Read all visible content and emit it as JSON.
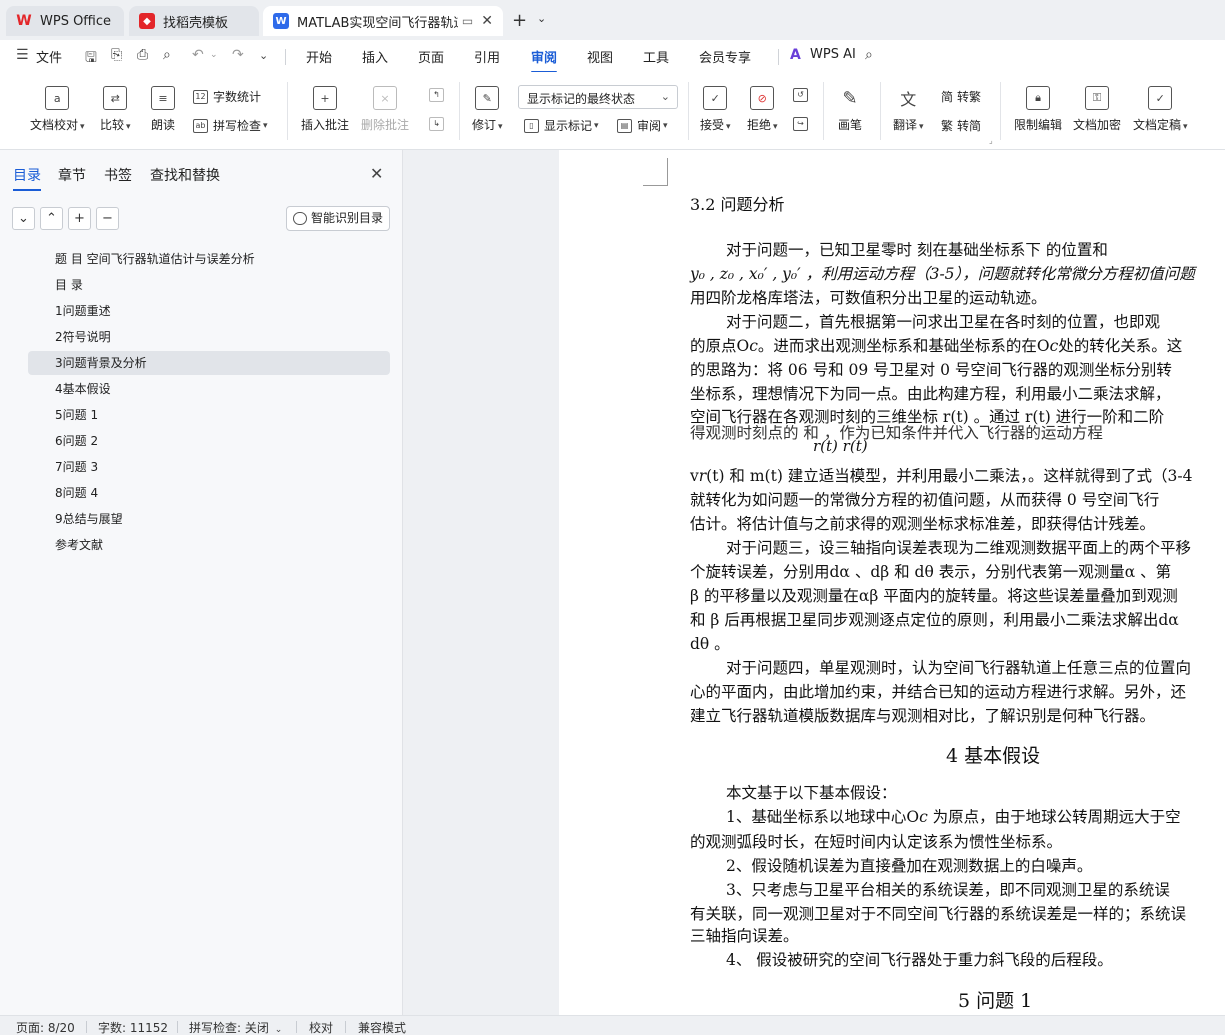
{
  "tabs": [
    {
      "label": "WPS Office",
      "icon": "wps-logo-icon"
    },
    {
      "label": "找稻壳模板",
      "icon": "docer-icon"
    },
    {
      "label": "MATLAB实现空间飞行器轨道估计",
      "icon": "writer-doc-icon",
      "active": true
    }
  ],
  "menu": {
    "file": "文件",
    "tabs": [
      "开始",
      "插入",
      "页面",
      "引用",
      "审阅",
      "视图",
      "工具",
      "会员专享"
    ],
    "active_tab": "审阅",
    "ai": "WPS AI"
  },
  "ribbon": {
    "doc_proof": "文档校对",
    "compare": "比较",
    "read_aloud": "朗读",
    "word_count": "字数统计",
    "spell_check": "拼写检查",
    "insert_comment": "插入批注",
    "delete_comment": "删除批注",
    "revise": "修订",
    "markup_mode": "显示标记的最终状态",
    "show_markup": "显示标记",
    "review_pane": "审阅",
    "accept": "接受",
    "reject": "拒绝",
    "pen": "画笔",
    "translate": "翻译",
    "to_traditional": "转繁",
    "to_simplified": "转简",
    "restrict_edit": "限制编辑",
    "encrypt": "文档加密",
    "finalize": "文档定稿"
  },
  "sidebar": {
    "tabs": [
      "目录",
      "章节",
      "书签",
      "查找和替换"
    ],
    "active_tab": "目录",
    "smart_toc": "智能识别目录",
    "toc": [
      "题 目 空间飞行器轨道估计与误差分析",
      "目 录",
      "1问题重述",
      "2符号说明",
      "3问题背景及分析",
      "4基本假设",
      "5问题 1",
      "6问题 2",
      "7问题 3",
      "8问题 4",
      "9总结与展望",
      "参考文献"
    ],
    "selected_index": 4
  },
  "document": {
    "section_title": "3.2  问题分析",
    "lines": [
      "对于问题一，已知卫星零时  刻在基础坐标系下  的位置和",
      "y₀ , z₀ , x₀′ , y₀′ ，利用运动方程（3-5），问题就转化常微分方程初值问题",
      "用四阶龙格库塔法，可数值积分出卫星的运动轨迹。",
      "对于问题二，首先根据第一问求出卫星在各时刻的位置，也即观",
      "的原点O𝑐。进而求出观测坐标系和基础坐标系的在O𝑐处的转化关系。这",
      "的思路为：将  06 号和  09 号卫星对  0 号空间飞行器的观测坐标分别转",
      "坐标系，理想情况下为同一点。由此构建方程，利用最小二乘法求解，",
      "空间飞行器在各观测时刻的三维坐标  r(t) 。通过 r(t) 进行一阶和二阶",
      "得观测时刻点的      和      ，作为已知条件并代入飞行器的运动方程",
      "v𝑟(t) 和 m(t) 建立适当模型，并利用最小二乘法，。这样就得到了式（3-4",
      "就转化为如问题一的常微分方程的初值问题，从而获得  0 号空间飞行",
      "估计。将估计值与之前求得的观测坐标求标准差，即获得估计残差。",
      "对于问题三，设三轴指向误差表现为二维观测数据平面上的两个平移",
      "个旋转误差，分别用dα 、dβ 和 dθ 表示，分别代表第一观测量α 、第",
      "β 的平移量以及观测量在αβ 平面内的旋转量。将这些误差量叠加到观测",
      "和 β 后再根据卫星同步观测逐点定位的原则，利用最小二乘法求解出dα",
      "dθ 。",
      "对于问题四，单星观测时，认为空间飞行器轨道上任意三点的位置向",
      "心的平面内，由此增加约束，并结合已知的运动方程进行求解。另外，还",
      "建立飞行器轨道模版数据库与观测相对比，了解识别是何种飞行器。"
    ],
    "formula_fragment": "r(t)    r(t)",
    "heading_4": "4 基本假设",
    "assumption_lines": [
      "本文基于以下基本假设：",
      "1、基础坐标系以地球中心O𝑐 为原点，由于地球公转周期远大于空",
      "的观测弧段时长，在短时间内认定该系为惯性坐标系。",
      "2、假设随机误差为直接叠加在观测数据上的白噪声。",
      "3、只考虑与卫星平台相关的系统误差，即不同观测卫星的系统误",
      "有关联，同一观测卫星对于不同空间飞行器的系统误差是一样的；系统误",
      "三轴指向误差。",
      "4、    假设被研究的空间飞行器处于重力斜飞段的后程段。"
    ],
    "heading_5": "5 问题 1"
  },
  "status": {
    "page": "页面: 8/20",
    "words": "字数: 11152",
    "spell": "拼写检查: 关闭",
    "proof": "校对",
    "compat": "兼容模式"
  },
  "colors": {
    "accent": "#1a5cd6",
    "brand_red": "#e3262a",
    "doc_blue": "#2f6bea"
  }
}
